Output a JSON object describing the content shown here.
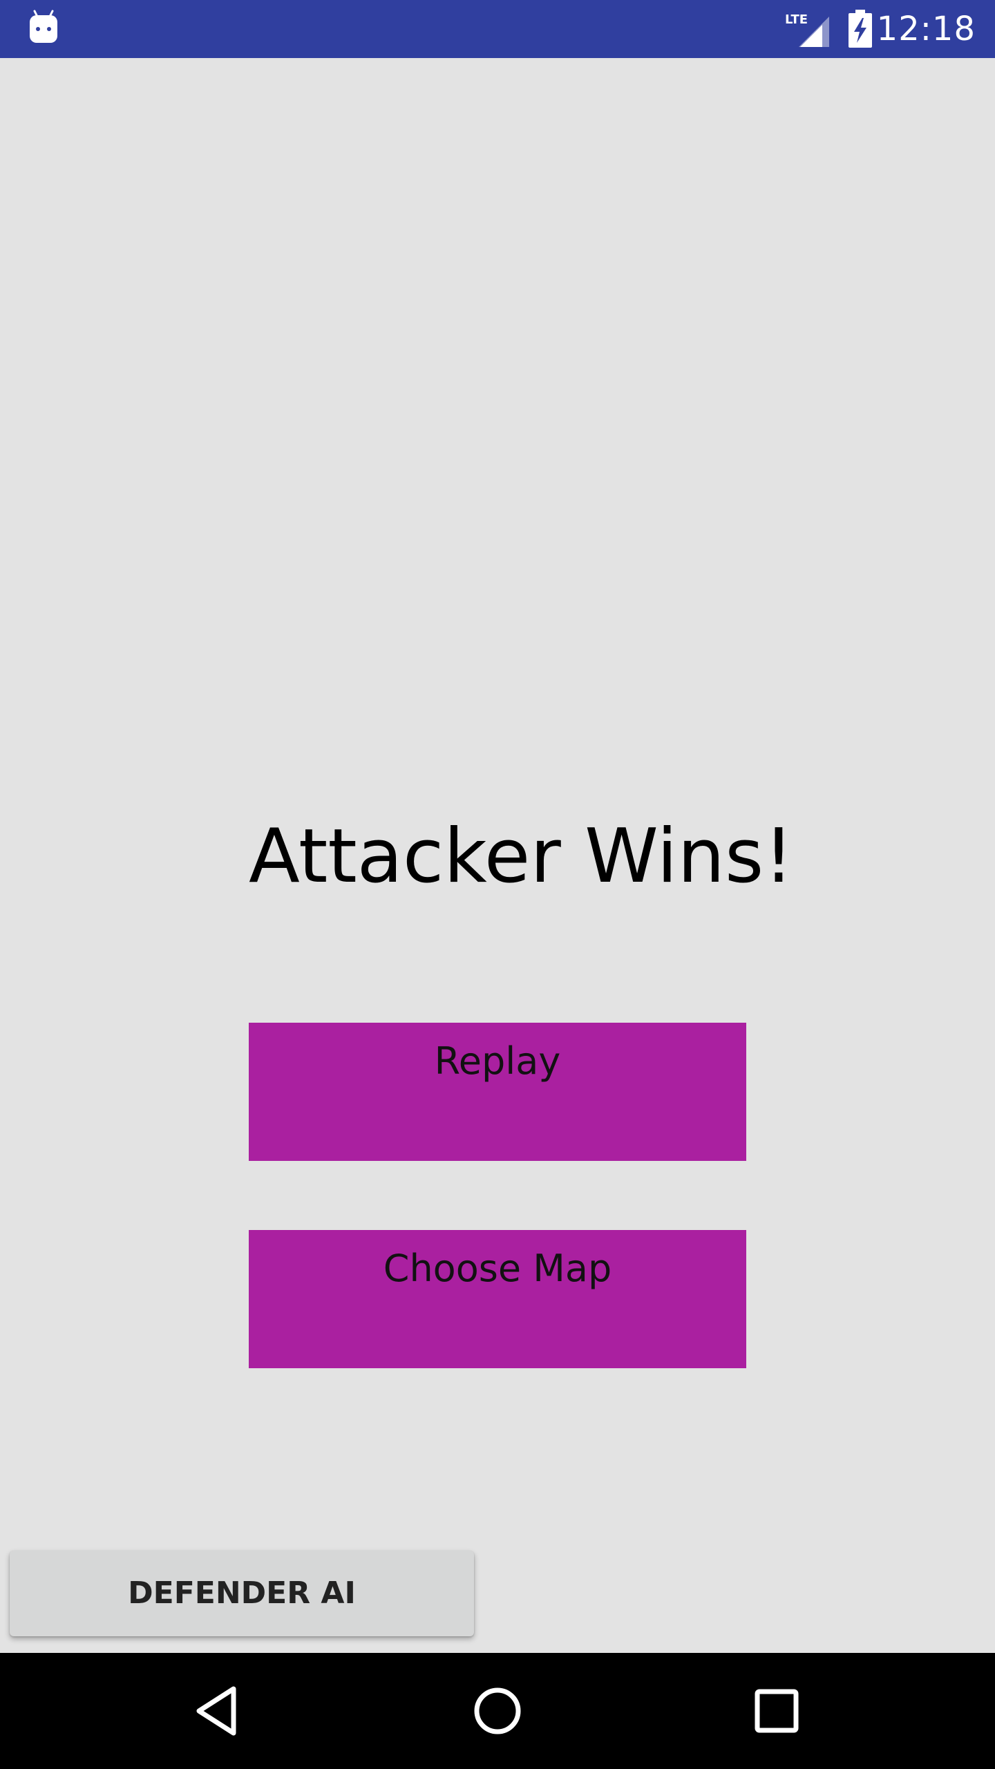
{
  "status_bar": {
    "time": "12:18",
    "network_label": "LTE",
    "icons": [
      "android-icon",
      "lte-signal-icon",
      "battery-charging-icon"
    ],
    "background_color": "#303f9f"
  },
  "main": {
    "result_title": "Attacker Wins!",
    "buttons": [
      {
        "label": "Replay"
      },
      {
        "label": "Choose Map"
      }
    ],
    "button_color": "#aa20a0",
    "background_color": "#e3e3e3"
  },
  "footer": {
    "defender_button_label": "DEFENDER AI"
  },
  "nav_bar": {
    "icons": [
      "back-icon",
      "home-icon",
      "recents-icon"
    ]
  }
}
